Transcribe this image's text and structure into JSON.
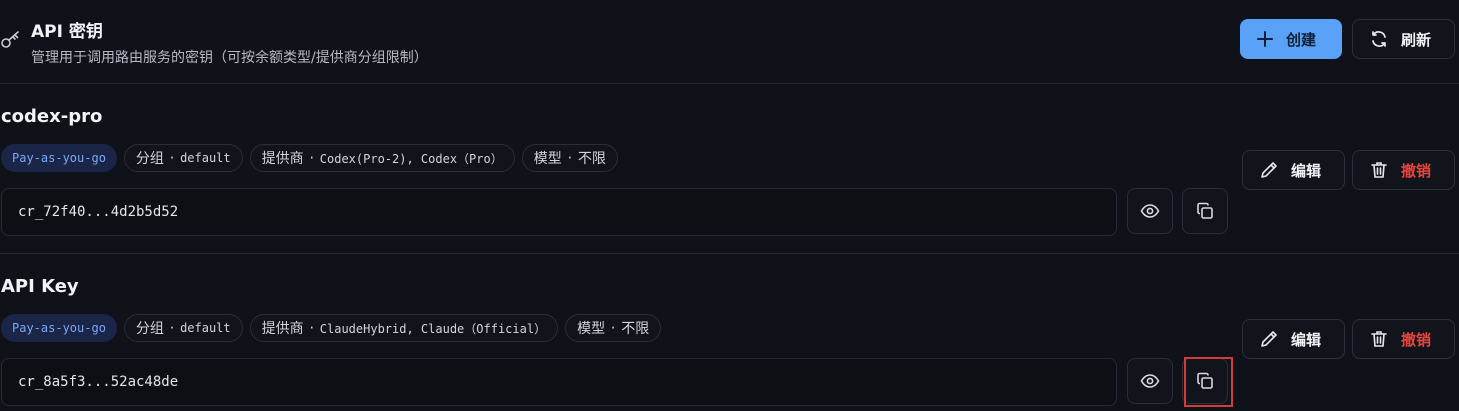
{
  "header": {
    "title": "API 密钥",
    "subtitle": "管理用于调用路由服务的密钥（可按余额类型/提供商分组限制）",
    "create_label": "创建",
    "refresh_label": "刷新"
  },
  "keys": [
    {
      "name": "codex-pro",
      "billing": "Pay-as-you-go",
      "group_label": "分组",
      "group_value": "default",
      "provider_label": "提供商",
      "provider_value": "Codex(Pro-2), Codex（Pro）",
      "model_label": "模型",
      "model_value": "不限",
      "masked_key": "cr_72f40...4d2b5d52",
      "edit_label": "编辑",
      "revoke_label": "撤销"
    },
    {
      "name": "API Key",
      "billing": "Pay-as-you-go",
      "group_label": "分组",
      "group_value": "default",
      "provider_label": "提供商",
      "provider_value": "ClaudeHybrid, Claude（Official）",
      "model_label": "模型",
      "model_value": "不限",
      "masked_key": "cr_8a5f3...52ac48de",
      "edit_label": "编辑",
      "revoke_label": "撤销"
    }
  ],
  "separator": "·",
  "colors": {
    "background": "#101219",
    "accent": "#5aa2f8",
    "danger": "#e6453e",
    "billing_tag": "#7aa8f5",
    "highlight": "#d33a3a"
  },
  "icons": [
    "key-icon",
    "plus-icon",
    "refresh-icon",
    "eye-icon",
    "copy-icon",
    "pencil-icon",
    "trash-icon"
  ]
}
